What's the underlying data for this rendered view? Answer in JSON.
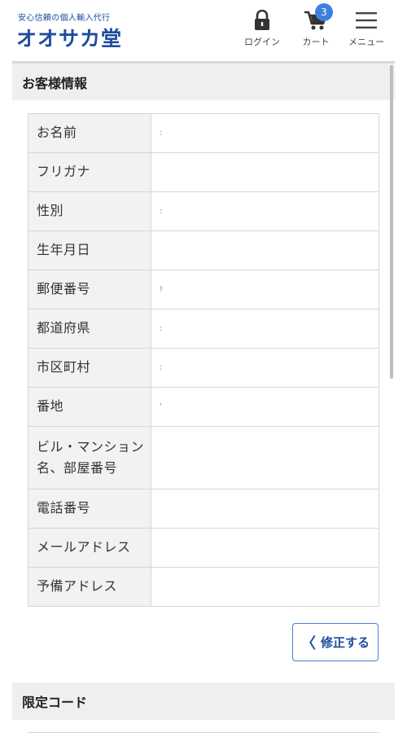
{
  "header": {
    "tagline": "安心信頼の個人輸入代行",
    "logo": "オオサカ堂",
    "nav": {
      "login_label": "ログイン",
      "login_icon": "lock-icon",
      "cart_label": "カート",
      "cart_icon": "cart-icon",
      "cart_count": "3",
      "menu_label": "メニュー",
      "menu_icon": "hamburger-icon"
    }
  },
  "colors": {
    "brand": "#1e4ca0",
    "badge": "#3f7fe0",
    "section_bg": "#efefef"
  },
  "customer_section": {
    "title": "お客様情報",
    "rows": [
      {
        "label": "お名前",
        "value": ":"
      },
      {
        "label": "フリガナ",
        "value": ""
      },
      {
        "label": "性別",
        "value": ":"
      },
      {
        "label": "生年月日",
        "value": ""
      },
      {
        "label": "郵便番号",
        "value": "!"
      },
      {
        "label": "都道府県",
        "value": ":"
      },
      {
        "label": "市区町村",
        "value": ":"
      },
      {
        "label": "番地",
        "value": "'"
      },
      {
        "label": "ビル・マンション名、部屋番号",
        "value": ""
      },
      {
        "label": "電話番号",
        "value": ""
      },
      {
        "label": "メールアドレス",
        "value": ""
      },
      {
        "label": "予備アドレス",
        "value": ""
      }
    ],
    "edit_label": "修正する"
  },
  "code_section": {
    "title": "限定コード"
  }
}
